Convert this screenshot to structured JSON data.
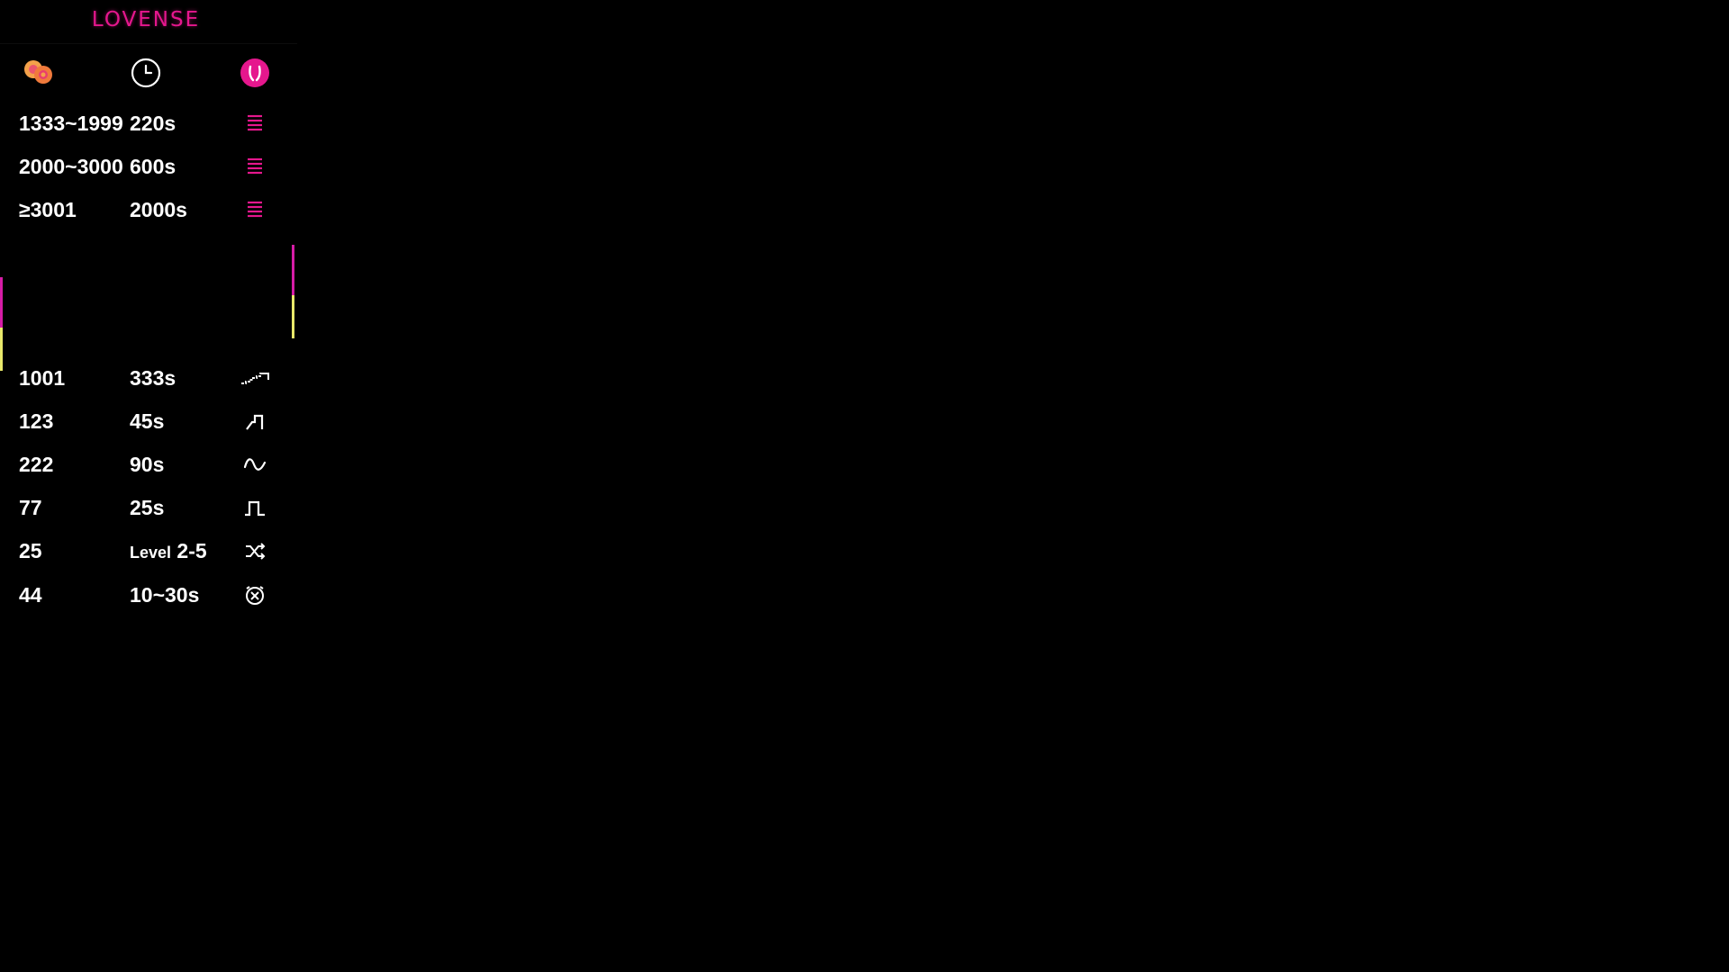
{
  "brand": {
    "logo_text": "LOVENSE",
    "accent": "#e5178d"
  },
  "header_icons": [
    {
      "name": "tip-coins-icon"
    },
    {
      "name": "clock-icon"
    },
    {
      "name": "toy-icon"
    }
  ],
  "top_levels": [
    {
      "tokens": "1333~1999",
      "duration": "220s",
      "icon": "vibration-bars-icon"
    },
    {
      "tokens": "2000~3000",
      "duration": "600s",
      "icon": "vibration-bars-icon"
    },
    {
      "tokens": "≥3001",
      "duration": "2000s",
      "icon": "vibration-bars-icon"
    }
  ],
  "special_levels": [
    {
      "tokens": "1001",
      "duration": "333s",
      "icon": "earthquake-pattern-icon"
    },
    {
      "tokens": "123",
      "duration": "45s",
      "icon": "fireworks-pattern-icon"
    },
    {
      "tokens": "222",
      "duration": "90s",
      "icon": "wave-pattern-icon"
    },
    {
      "tokens": "77",
      "duration": "25s",
      "icon": "pulse-pattern-icon"
    },
    {
      "tokens": "25",
      "duration_prefix": "Level",
      "duration": "2-5",
      "icon": "random-shuffle-icon"
    },
    {
      "tokens": "44",
      "duration": "10~30s",
      "icon": "alarm-clock-icon"
    }
  ],
  "colors": {
    "bar_magenta": "#d61ca6",
    "bar_yellow": "#e8e86a"
  }
}
